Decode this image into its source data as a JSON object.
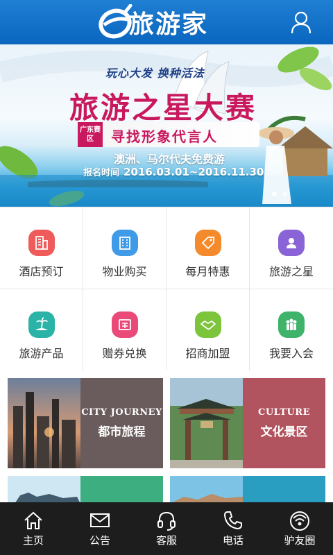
{
  "header": {
    "logo_text": "旅游家",
    "logo_mark": "e",
    "user_icon": "user-icon",
    "bg_color": "#0a66bf"
  },
  "banner": {
    "slogan": "玩心大发 换种活法",
    "title": "旅游之星大赛",
    "region_tag": "广东赛区",
    "ribbon_text": "寻找形象代言人",
    "prize": "澳洲、马尔代夫免费游",
    "period_label": "报名时间",
    "period": "2016.03.01~2016.11.30",
    "slide_count": 2,
    "active_slide": 1,
    "accent_color": "#c8185e"
  },
  "menu": [
    {
      "label": "酒店预订",
      "icon": "hotel-icon",
      "color": "#ef5a5a"
    },
    {
      "label": "物业购买",
      "icon": "building-icon",
      "color": "#3f9be8"
    },
    {
      "label": "每月特惠",
      "icon": "tag-icon",
      "color": "#f48a2c"
    },
    {
      "label": "旅游之星",
      "icon": "person-icon",
      "color": "#8a64d6"
    },
    {
      "label": "旅游产品",
      "icon": "palm-island-icon",
      "color": "#2ab3a6"
    },
    {
      "label": "赠券兑换",
      "icon": "coupon-icon",
      "color": "#e94a78"
    },
    {
      "label": "招商加盟",
      "icon": "handshake-icon",
      "color": "#7cc43a"
    },
    {
      "label": "我要入会",
      "icon": "group-icon",
      "color": "#3fb36a"
    }
  ],
  "cards": [
    {
      "en": "CITY JOURNEY",
      "cn": "都市旅程",
      "panel_color": "#6a5c5c"
    },
    {
      "en": "CULTURE",
      "cn": "文化景区",
      "panel_color": "#b2545f"
    },
    {
      "panel_color": "#3cae80"
    },
    {
      "panel_color": "#2a9ec0"
    }
  ],
  "bottom_nav": [
    {
      "label": "主页",
      "icon": "home-icon"
    },
    {
      "label": "公告",
      "icon": "mail-icon"
    },
    {
      "label": "客服",
      "icon": "headset-icon"
    },
    {
      "label": "电话",
      "icon": "phone-icon"
    },
    {
      "label": "驴友圈",
      "icon": "signal-circle-icon"
    }
  ]
}
